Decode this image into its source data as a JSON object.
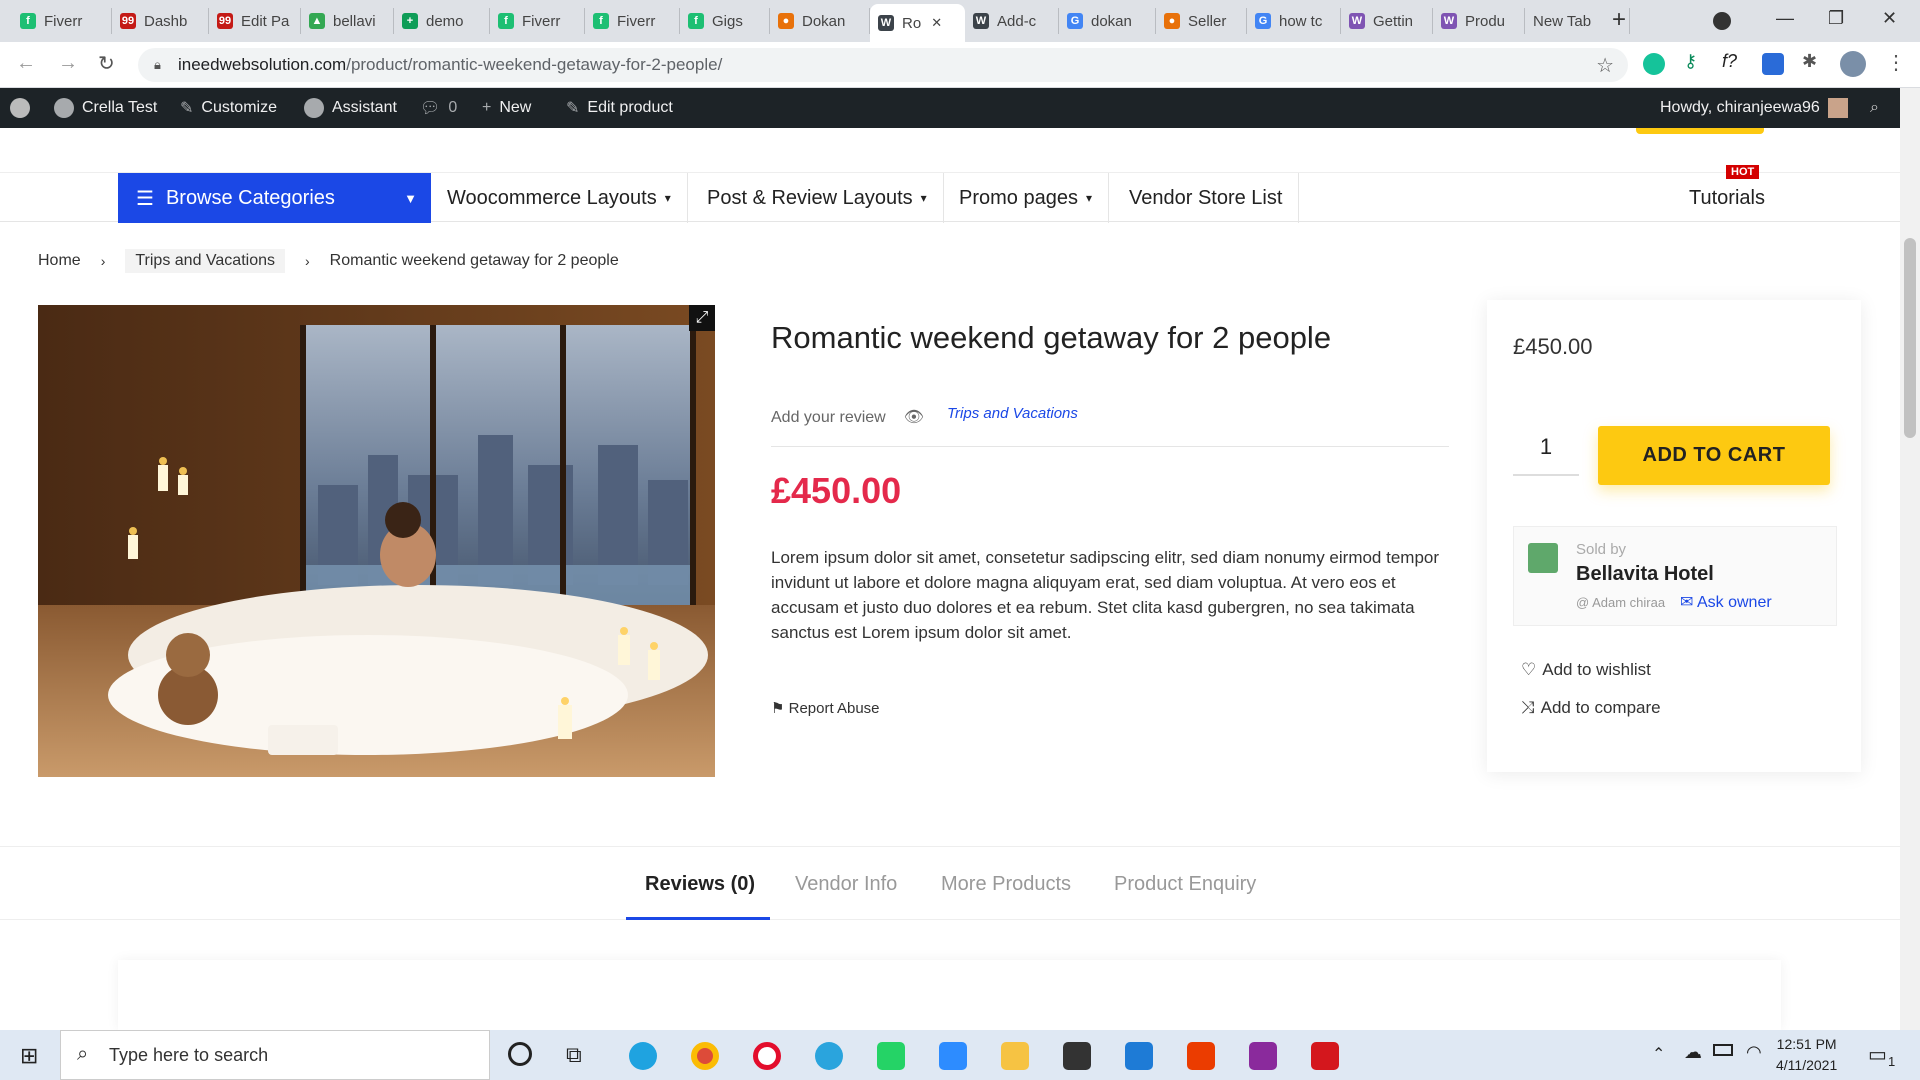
{
  "browser": {
    "tabs": [
      {
        "label": "Fiverr",
        "color": "#1dbf73",
        "glyph": "f"
      },
      {
        "label": "Dashb",
        "color": "#c41a16",
        "glyph": "99"
      },
      {
        "label": "Edit Pa",
        "color": "#c41a16",
        "glyph": "99"
      },
      {
        "label": "bellavi",
        "color": "#34a853",
        "glyph": "▲"
      },
      {
        "label": "demo",
        "color": "#0f9d58",
        "glyph": "+"
      },
      {
        "label": "Fiverr",
        "color": "#1dbf73",
        "glyph": "f"
      },
      {
        "label": "Fiverr",
        "color": "#1dbf73",
        "glyph": "f"
      },
      {
        "label": "Gigs",
        "color": "#1dbf73",
        "glyph": "f"
      },
      {
        "label": "Dokan",
        "color": "#e8710a",
        "glyph": "●"
      },
      {
        "label": "Ro",
        "color": "#3c434a",
        "glyph": "W"
      },
      {
        "label": "Add-c",
        "color": "#3c434a",
        "glyph": "W"
      },
      {
        "label": "dokan",
        "color": "#4285f4",
        "glyph": "G"
      },
      {
        "label": "Seller",
        "color": "#e8710a",
        "glyph": "●"
      },
      {
        "label": "how tc",
        "color": "#4285f4",
        "glyph": "G"
      },
      {
        "label": "Gettin",
        "color": "#7f54b3",
        "glyph": "W"
      },
      {
        "label": "Produ",
        "color": "#7f54b3",
        "glyph": "W"
      },
      {
        "label": "New Tab",
        "color": "",
        "glyph": ""
      }
    ],
    "url_host": "ineedwebsolution.com",
    "url_path": "/product/romantic-weekend-getaway-for-2-people/"
  },
  "wpbar": {
    "site": "Crella Test",
    "customize": "Customize",
    "assistant": "Assistant",
    "comments": "0",
    "new": "New",
    "edit": "Edit product",
    "howdy": "Howdy, chiranjeewa96"
  },
  "nav": {
    "browse": "Browse Categories",
    "items": [
      "Woocommerce Layouts",
      "Post & Review Layouts",
      "Promo pages",
      "Vendor Store List"
    ],
    "tutorials": "Tutorials",
    "hot": "HOT"
  },
  "breadcrumb": [
    "Home",
    "Trips and Vacations",
    "Romantic weekend getaway for 2 people"
  ],
  "product": {
    "title": "Romantic weekend getaway for 2 people",
    "review_link": "Add your review",
    "category": "Trips and Vacations",
    "price": "£450.00",
    "description": "Lorem ipsum dolor sit amet, consetetur sadipscing elitr, sed diam nonumy eirmod tempor invidunt ut labore et dolore magna aliquyam erat, sed diam voluptua. At vero eos et accusam et justo duo dolores et ea rebum. Stet clita kasd gubergren, no sea takimata sanctus est Lorem ipsum dolor sit amet.",
    "report": "Report Abuse"
  },
  "sidebar": {
    "price": "£450.00",
    "qty": "1",
    "add_to_cart": "ADD TO CART",
    "sold_by": "Sold by",
    "vendor": "Bellavita Hotel",
    "vendor_user": "@ Adam chiraa",
    "ask_owner": "Ask owner",
    "wishlist": "Add to wishlist",
    "compare": "Add to compare"
  },
  "tabs": [
    "Reviews (0)",
    "Vendor Info",
    "More Products",
    "Product Enquiry"
  ],
  "taskbar": {
    "search_placeholder": "Type here to search",
    "time": "12:51 PM",
    "date": "4/11/2021",
    "notifications": "1"
  }
}
